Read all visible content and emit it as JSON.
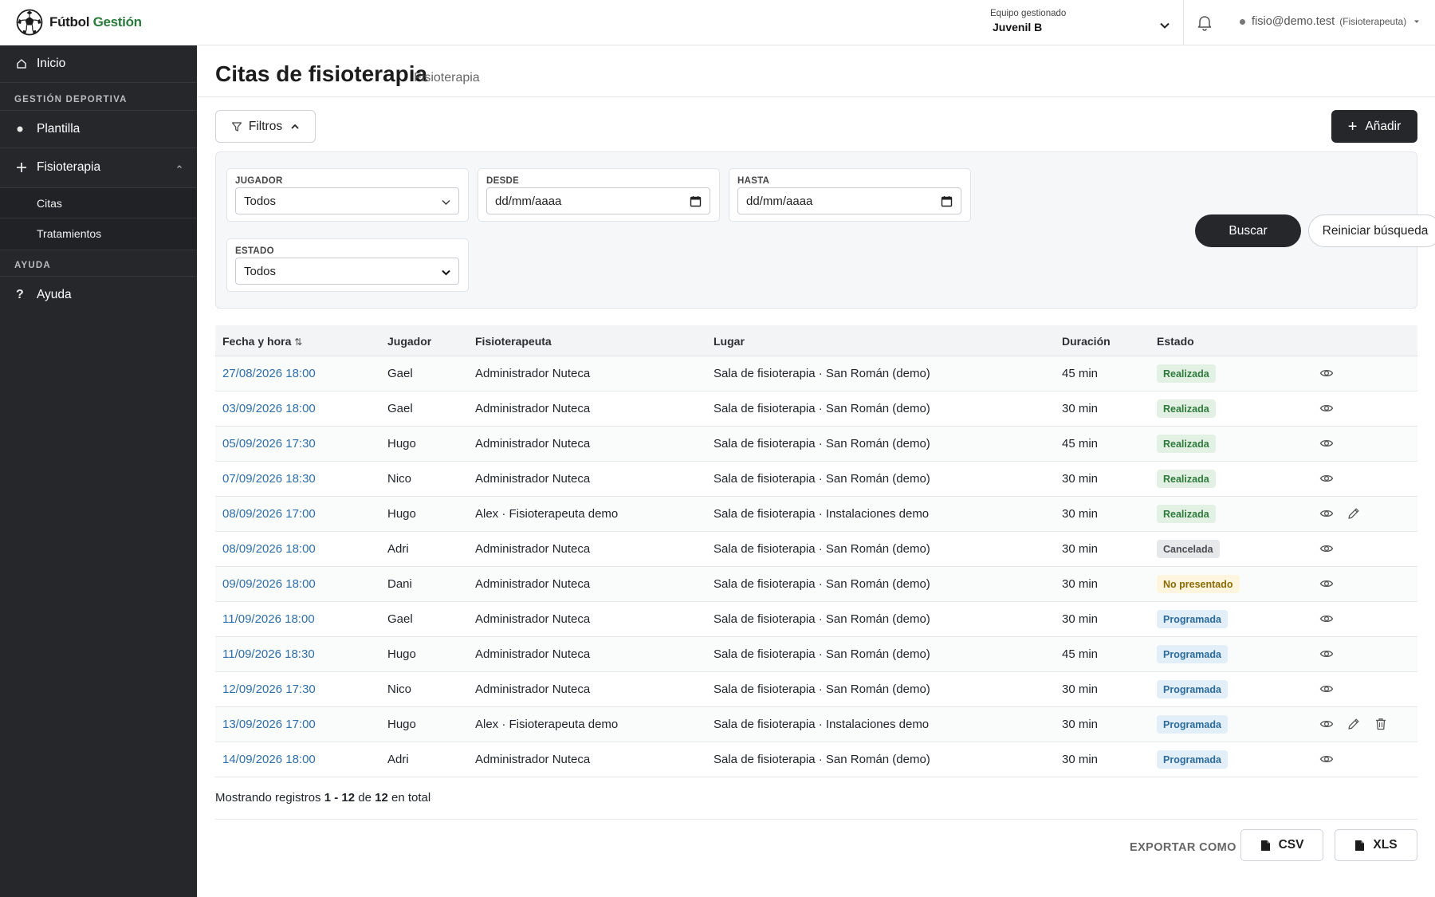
{
  "app": {
    "logo_primary": "Fútbol",
    "logo_secondary": "Gestión",
    "brand_color": "#2a7a3b"
  },
  "header": {
    "team_label": "Equipo gestionado",
    "team_value": "Juvenil B",
    "user_email": "fisio@demo.test",
    "user_role": "(Fisioterapeuta)"
  },
  "sidebar": {
    "home": "Inicio",
    "section_sports": "GESTIÓN DEPORTIVA",
    "plantilla": "Plantilla",
    "fisioterapia": "Fisioterapia",
    "sub_citas": "Citas",
    "sub_tratamientos": "Tratamientos",
    "section_help": "AYUDA",
    "ayuda": "Ayuda"
  },
  "page": {
    "title": "Citas de fisioterapia",
    "subtitle": "Fisioterapia",
    "filters_button": "Filtros",
    "add_button": "Añadir"
  },
  "filters": {
    "player_label": "JUGADOR",
    "player_value": "Todos",
    "from_label": "DESDE",
    "from_placeholder": "dd/mm/aaaa",
    "to_label": "HASTA",
    "to_placeholder": "dd/mm/aaaa",
    "status_label": "ESTADO",
    "status_value": "Todos",
    "search_button": "Buscar",
    "reset_button": "Reiniciar búsqueda"
  },
  "table": {
    "headers": {
      "date": "Fecha y hora",
      "sort_indicator": "⇅",
      "player": "Jugador",
      "physio": "Fisioterapeuta",
      "place": "Lugar",
      "duration": "Duración",
      "status": "Estado"
    },
    "rows": [
      {
        "date": "27/08/2026 18:00",
        "player": "Gael",
        "physio": "Administrador Nuteca",
        "place": "Sala de fisioterapia · San Román (demo)",
        "duration": "45 min",
        "status": "Realizada",
        "status_kind": "realizada",
        "edit": false,
        "delete": false
      },
      {
        "date": "03/09/2026 18:00",
        "player": "Gael",
        "physio": "Administrador Nuteca",
        "place": "Sala de fisioterapia · San Román (demo)",
        "duration": "30 min",
        "status": "Realizada",
        "status_kind": "realizada",
        "edit": false,
        "delete": false
      },
      {
        "date": "05/09/2026 17:30",
        "player": "Hugo",
        "physio": "Administrador Nuteca",
        "place": "Sala de fisioterapia · San Román (demo)",
        "duration": "45 min",
        "status": "Realizada",
        "status_kind": "realizada",
        "edit": false,
        "delete": false
      },
      {
        "date": "07/09/2026 18:30",
        "player": "Nico",
        "physio": "Administrador Nuteca",
        "place": "Sala de fisioterapia · San Román (demo)",
        "duration": "30 min",
        "status": "Realizada",
        "status_kind": "realizada",
        "edit": false,
        "delete": false
      },
      {
        "date": "08/09/2026 17:00",
        "player": "Hugo",
        "physio": "Alex · Fisioterapeuta demo",
        "place": "Sala de fisioterapia · Instalaciones demo",
        "duration": "30 min",
        "status": "Realizada",
        "status_kind": "realizada",
        "edit": true,
        "delete": false
      },
      {
        "date": "08/09/2026 18:00",
        "player": "Adri",
        "physio": "Administrador Nuteca",
        "place": "Sala de fisioterapia · San Román (demo)",
        "duration": "30 min",
        "status": "Cancelada",
        "status_kind": "cancelada",
        "edit": false,
        "delete": false
      },
      {
        "date": "09/09/2026 18:00",
        "player": "Dani",
        "physio": "Administrador Nuteca",
        "place": "Sala de fisioterapia · San Román (demo)",
        "duration": "30 min",
        "status": "No presentado",
        "status_kind": "nopresentado",
        "edit": false,
        "delete": false
      },
      {
        "date": "11/09/2026 18:00",
        "player": "Gael",
        "physio": "Administrador Nuteca",
        "place": "Sala de fisioterapia · San Román (demo)",
        "duration": "30 min",
        "status": "Programada",
        "status_kind": "programada",
        "edit": false,
        "delete": false
      },
      {
        "date": "11/09/2026 18:30",
        "player": "Hugo",
        "physio": "Administrador Nuteca",
        "place": "Sala de fisioterapia · San Román (demo)",
        "duration": "45 min",
        "status": "Programada",
        "status_kind": "programada",
        "edit": false,
        "delete": false
      },
      {
        "date": "12/09/2026 17:30",
        "player": "Nico",
        "physio": "Administrador Nuteca",
        "place": "Sala de fisioterapia · San Román (demo)",
        "duration": "30 min",
        "status": "Programada",
        "status_kind": "programada",
        "edit": false,
        "delete": false
      },
      {
        "date": "13/09/2026 17:00",
        "player": "Hugo",
        "physio": "Alex · Fisioterapeuta demo",
        "place": "Sala de fisioterapia · Instalaciones demo",
        "duration": "30 min",
        "status": "Programada",
        "status_kind": "programada",
        "edit": true,
        "delete": true
      },
      {
        "date": "14/09/2026 18:00",
        "player": "Adri",
        "physio": "Administrador Nuteca",
        "place": "Sala de fisioterapia · San Román (demo)",
        "duration": "30 min",
        "status": "Programada",
        "status_kind": "programada",
        "edit": false,
        "delete": false
      }
    ]
  },
  "footer": {
    "summary_prefix": "Mostrando registros",
    "summary_range": "1 - 12",
    "summary_of": "de",
    "summary_total": "12",
    "summary_suffix": "en total",
    "export_label": "EXPORTAR COMO",
    "csv": "CSV",
    "xls": "XLS"
  }
}
